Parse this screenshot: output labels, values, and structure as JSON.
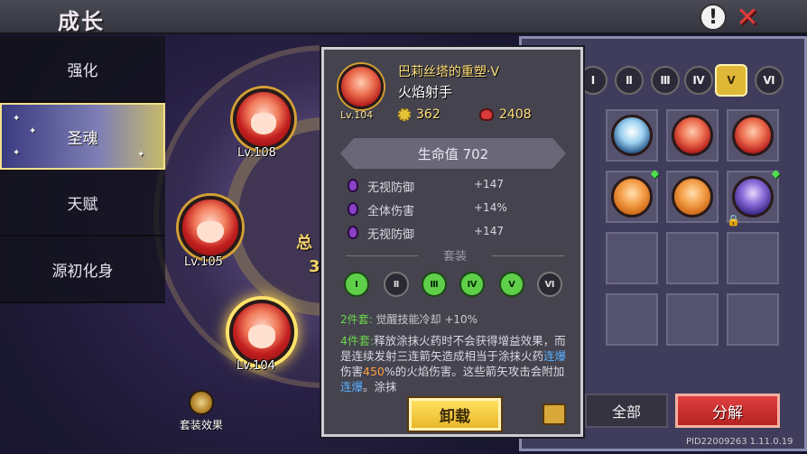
{
  "header": {
    "title": "成长",
    "info_label": "!",
    "close_label": "✕"
  },
  "sidebar": {
    "items": [
      {
        "label": "强化"
      },
      {
        "label": "圣魂"
      },
      {
        "label": "天赋"
      },
      {
        "label": "源初化身"
      }
    ],
    "active": "圣魂"
  },
  "wheel": {
    "heroes": [
      {
        "level": "Lv.108"
      },
      {
        "level": "Lv.105"
      },
      {
        "level": "Lv.104"
      }
    ],
    "partial_text_1": "总",
    "partial_text_2": "3",
    "set_effect_label": "套装效果"
  },
  "detail": {
    "name": "巴莉丝塔的重塑·Ⅴ",
    "title": "火焰射手",
    "level": "Lv.104",
    "stat_gear": "362",
    "stat_power": "2408",
    "hp_label": "生命值 702",
    "attributes": [
      {
        "name": "无视防御",
        "value": "+147"
      },
      {
        "name": "全体伤害",
        "value": "+14%"
      },
      {
        "name": "无视防御",
        "value": "+147"
      }
    ],
    "set_title": "套装",
    "set_icons": [
      {
        "label": "Ⅰ",
        "active": true
      },
      {
        "label": "Ⅱ",
        "active": false
      },
      {
        "label": "Ⅲ",
        "active": true
      },
      {
        "label": "Ⅳ",
        "active": true
      },
      {
        "label": "Ⅴ",
        "active": true
      },
      {
        "label": "Ⅵ",
        "active": false
      }
    ],
    "bonus2_prefix": "2件套:",
    "bonus2_text": "觉醒技能冷却 +10%",
    "bonus4_prefix": "4件套:",
    "bonus4_text_a": "释放涂抹火药时不会获得增益效果，而是连续发射三连箭矢造成相当于涂抹火药",
    "bonus4_kw1": "连爆",
    "bonus4_text_b": "伤害",
    "bonus4_pct": "450",
    "bonus4_text_c": "%的火焰伤害。这些箭矢攻击会附加",
    "bonus4_kw2": "连爆",
    "bonus4_text_d": "。涂抹",
    "unequip_label": "卸载"
  },
  "inventory": {
    "tiers": [
      "Ⅰ",
      "Ⅱ",
      "Ⅲ",
      "Ⅳ",
      "Ⅴ",
      "Ⅵ"
    ],
    "selected_tier": "Ⅴ",
    "all_label": "全部",
    "decompose_label": "分解"
  },
  "footer": {
    "pid": "PID22009263 1.11.0.19"
  }
}
